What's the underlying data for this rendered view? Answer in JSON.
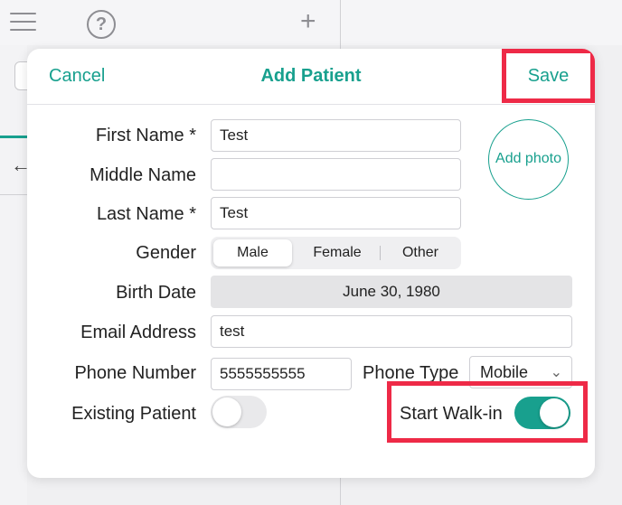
{
  "modal": {
    "title": "Add Patient",
    "cancel_label": "Cancel",
    "save_label": "Save"
  },
  "form": {
    "first_name": {
      "label": "First Name *",
      "value": "Test"
    },
    "middle_name": {
      "label": "Middle Name",
      "value": ""
    },
    "last_name": {
      "label": "Last Name *",
      "value": "Test"
    },
    "gender": {
      "label": "Gender",
      "options": [
        "Male",
        "Female",
        "Other"
      ],
      "selected": "Male"
    },
    "birth_date": {
      "label": "Birth Date",
      "value": "June 30, 1980"
    },
    "email": {
      "label": "Email Address",
      "value": "test"
    },
    "phone": {
      "label": "Phone Number",
      "value": "5555555555"
    },
    "phone_type": {
      "label": "Phone Type",
      "value": "Mobile"
    },
    "existing_patient": {
      "label": "Existing Patient",
      "on": false
    },
    "start_walkin": {
      "label": "Start Walk-in",
      "on": true
    }
  },
  "add_photo_label": "Add photo",
  "background": {
    "help_glyph": "?",
    "plus_glyph": "+",
    "back_glyph": "←"
  },
  "icons": [
    "hamburger-menu-icon",
    "help-icon",
    "plus-icon",
    "back-arrow-icon",
    "chevron-down-icon"
  ],
  "colors": {
    "accent": "#18a08e",
    "highlight": "#ee2a47"
  }
}
